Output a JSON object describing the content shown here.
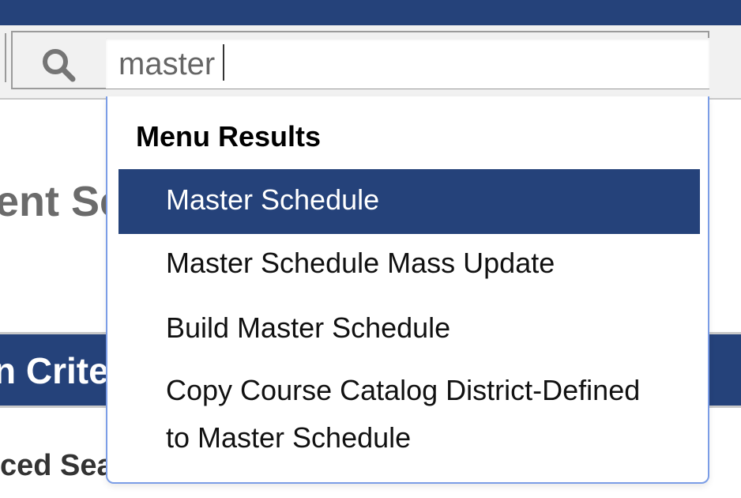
{
  "search": {
    "value": "master"
  },
  "background": {
    "page_title_fragment": "ent Se",
    "criteria_fragment": "n Crite",
    "advanced_fragment": "ced Sea"
  },
  "dropdown": {
    "header": "Menu Results",
    "results": [
      {
        "label": "Master Schedule",
        "selected": true
      },
      {
        "label": "Master Schedule Mass Update",
        "selected": false
      },
      {
        "label": "Build Master Schedule",
        "selected": false
      },
      {
        "label_line1": "Copy Course Catalog District-Defined",
        "label_line2": "to Master Schedule",
        "selected": false
      }
    ]
  },
  "colors": {
    "brand_blue": "#25427a",
    "dropdown_border": "#7b9de6"
  }
}
